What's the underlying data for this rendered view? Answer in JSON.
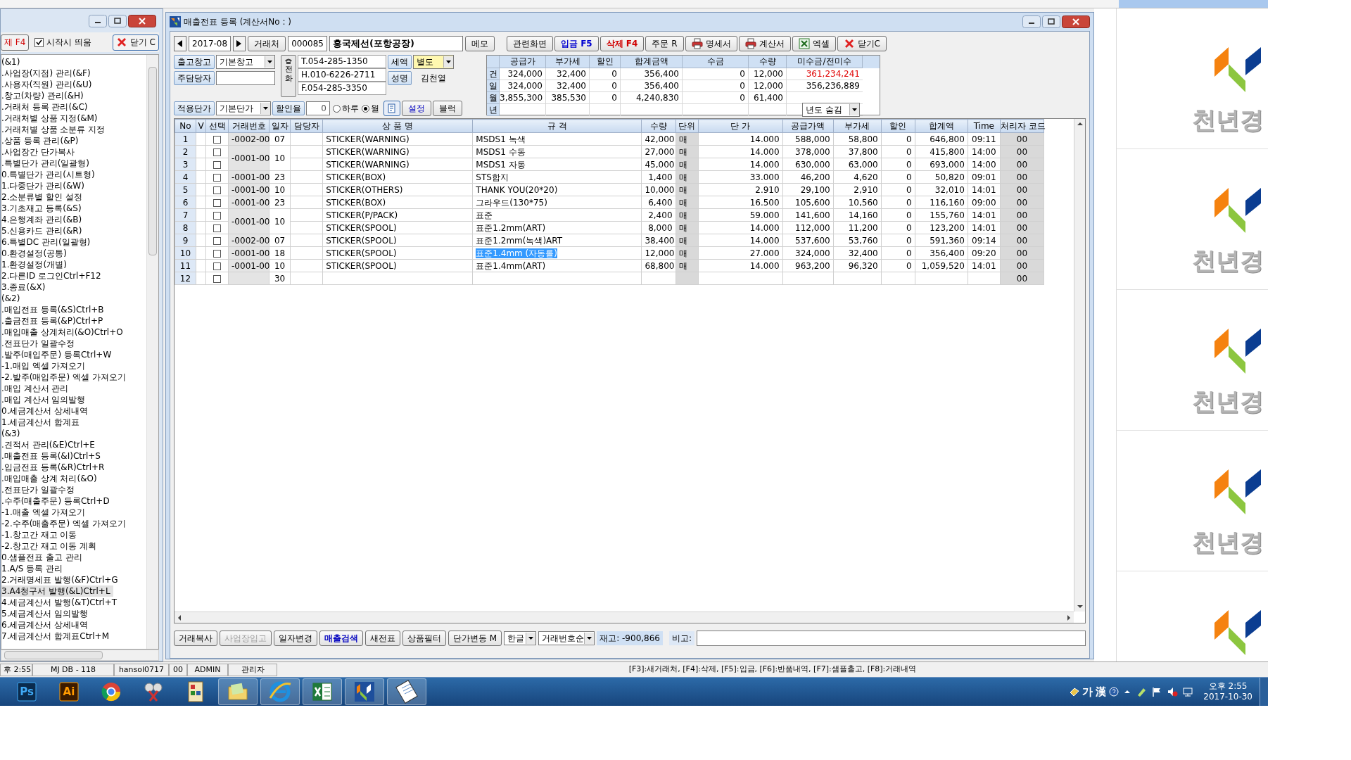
{
  "sidebar": {
    "delete_button": "제 F4",
    "startup_checkbox": {
      "label": "시작시 띄움",
      "checked": true
    },
    "close_button": "닫기 C",
    "items": [
      {
        "label": "(&1)",
        "selected": false
      },
      {
        "label": ".사업장(지점) 관리(&F)",
        "selected": false
      },
      {
        "label": ".사용자(직원) 관리(&U)",
        "selected": false
      },
      {
        "label": ".창고(차량) 관리(&H)",
        "selected": false
      },
      {
        "label": ".거래처 등록 관리(&C)",
        "selected": false
      },
      {
        "label": ".거래처별 상품 지정(&M)",
        "selected": false
      },
      {
        "label": ".거래처별 상품 소분류 지정",
        "selected": false
      },
      {
        "label": ".상품 등록 관리(&P)",
        "selected": false
      },
      {
        "label": ".사업장간 단가복사",
        "selected": false
      },
      {
        "label": ".특별단가 관리(일괄형)",
        "selected": false
      },
      {
        "label": "0.특별단가 관리(시트형)",
        "selected": false
      },
      {
        "label": "1.다중단가 관리(&W)",
        "selected": false
      },
      {
        "label": "2.소분류별 할인 설정",
        "selected": false
      },
      {
        "label": "3.기초재고 등록(&S)",
        "selected": false
      },
      {
        "label": "4.은행계좌 관리(&B)",
        "selected": false
      },
      {
        "label": "5.신용카드 관리(&R)",
        "selected": false
      },
      {
        "label": "6.특별DC 관리(일괄형)",
        "selected": false
      },
      {
        "label": "0.환경설정(공통)",
        "selected": false
      },
      {
        "label": "1.환경설정(개별)",
        "selected": false
      },
      {
        "label": "2.다른ID 로그인Ctrl+F12",
        "selected": false
      },
      {
        "label": "3.종료(&X)",
        "selected": false
      },
      {
        "label": "(&2)",
        "selected": false
      },
      {
        "label": ".매입전표 등록(&S)Ctrl+B",
        "selected": false
      },
      {
        "label": ".출금전표 등록(&P)Ctrl+P",
        "selected": false
      },
      {
        "label": ".매입매출 상계처리(&O)Ctrl+O",
        "selected": false
      },
      {
        "label": ".전표단가 일괄수정",
        "selected": false
      },
      {
        "label": ".발주(매입주문) 등록Ctrl+W",
        "selected": false
      },
      {
        "label": "-1.매입 엑셀 가져오기",
        "selected": false
      },
      {
        "label": "-2.발주(매입주문) 엑셀 가져오기",
        "selected": false
      },
      {
        "label": ".매입 계산서 관리",
        "selected": false
      },
      {
        "label": ".매입 계산서 임의발행",
        "selected": false
      },
      {
        "label": "0.세금계산서 상세내역",
        "selected": false
      },
      {
        "label": "1.세금계산서 합계표",
        "selected": false
      },
      {
        "label": "(&3)",
        "selected": false
      },
      {
        "label": ".견적서 관리(&E)Ctrl+E",
        "selected": false
      },
      {
        "label": ".매출전표 등록(&I)Ctrl+S",
        "selected": false
      },
      {
        "label": ".입금전표 등록(&R)Ctrl+R",
        "selected": false
      },
      {
        "label": ".매입매출 상계 처리(&O)",
        "selected": false
      },
      {
        "label": ".전표단가 일괄수정",
        "selected": false
      },
      {
        "label": ".수주(매출주문) 등록Ctrl+D",
        "selected": false
      },
      {
        "label": "-1.매출 엑셀 가져오기",
        "selected": false
      },
      {
        "label": "-2.수주(매출주문) 엑셀 가져오기",
        "selected": false
      },
      {
        "label": "-1.창고간 재고 이동",
        "selected": false
      },
      {
        "label": "-2.창고간 재고 이동 계획",
        "selected": false
      },
      {
        "label": "0.샘플전표 출고 관리",
        "selected": false
      },
      {
        "label": "1.A/S 등록 관리",
        "selected": false
      },
      {
        "label": "2.거래명세표 발행(&F)Ctrl+G",
        "selected": false
      },
      {
        "label": "3.A4청구서 발행(&L)Ctrl+L",
        "selected": true
      },
      {
        "label": "4.세금계산서 발행(&T)Ctrl+T",
        "selected": false
      },
      {
        "label": "5.세금계산서 임의발행",
        "selected": false
      },
      {
        "label": "6.세금계산서 상세내역",
        "selected": false
      },
      {
        "label": "7.세금계산서 합계표Ctrl+M",
        "selected": false
      }
    ]
  },
  "window": {
    "title": "매출전표 등록 (계산서No : )"
  },
  "header": {
    "month": "2017-08",
    "client_label": "거래처",
    "client_code": "000085",
    "client_name": "흥국제선(포항공장)",
    "memo_button": "메모"
  },
  "actions": [
    {
      "label": "관련화면",
      "kind": "plain"
    },
    {
      "label": "입금 F5",
      "kind": "blue"
    },
    {
      "label": "삭제 F4",
      "kind": "red"
    },
    {
      "label": "주문 R",
      "kind": "plain"
    },
    {
      "label": "명세서",
      "kind": "print"
    },
    {
      "label": "계산서",
      "kind": "print"
    },
    {
      "label": "엑셀",
      "kind": "excel"
    },
    {
      "label": "닫기C",
      "kind": "close"
    }
  ],
  "form": {
    "warehouse": {
      "label": "출고창고",
      "value": "기본창고"
    },
    "manager": {
      "label": "주담당자"
    },
    "phone": {
      "label": "전화",
      "lines": [
        "T.054-285-1350",
        "H.010-6226-2711",
        "F.054-285-3350"
      ]
    },
    "tax": {
      "label": "세액",
      "value": "별도"
    },
    "person": {
      "label": "성명",
      "value": "김천열"
    },
    "price": {
      "label": "적용단가",
      "value": "기본단가"
    },
    "discount": {
      "label": "할인율",
      "value": "0"
    },
    "period": [
      {
        "label": "하루",
        "selected": false
      },
      {
        "label": "월",
        "selected": true
      }
    ],
    "buttons": [
      "설정",
      "블럭"
    ]
  },
  "summary": {
    "columns": [
      "공급가",
      "부가세",
      "할인",
      "합계금액",
      "수금",
      "수량",
      "미수금/전미수"
    ],
    "rows": [
      {
        "label": "건",
        "values": [
          "324,000",
          "32,400",
          "0",
          "356,400",
          "0",
          "12,000"
        ],
        "balance": {
          "text": "361,234,241",
          "color": "#e00000"
        }
      },
      {
        "label": "일",
        "values": [
          "324,000",
          "32,400",
          "0",
          "356,400",
          "0",
          "12,000"
        ],
        "balance": {
          "text": "356,236,889",
          "color": "#000000"
        }
      },
      {
        "label": "월",
        "values": [
          "3,855,300",
          "385,530",
          "0",
          "4,240,830",
          "0",
          "61,400"
        ]
      },
      {
        "label": "년",
        "year_select": "년도 숨김"
      }
    ]
  },
  "table": {
    "columns": [
      "No",
      "V",
      "선택",
      "거래번호",
      "일자",
      "담당자",
      "상 품 명",
      "규 격",
      "수량",
      "단위",
      "단 가",
      "공급가액",
      "부가세",
      "할인",
      "합계액",
      "Time",
      "처리자 코드"
    ],
    "groups": [
      {
        "trade_no": "-0002-00",
        "date": "07",
        "rows": [
          {
            "no": "1",
            "checked": false,
            "product": "STICKER(WARNING)",
            "spec": "MSDS1 녹색",
            "selected": false,
            "qty": "42,000",
            "unit": "매",
            "price": "14.000",
            "supply": "588,000",
            "vat": "58,800",
            "discount": "0",
            "total": "646,800",
            "time": "09:11",
            "handler": "00"
          }
        ]
      },
      {
        "trade_no": "-0001-00",
        "date": "10",
        "rows": [
          {
            "no": "2",
            "checked": false,
            "product": "STICKER(WARNING)",
            "spec": "MSDS1 수동",
            "selected": false,
            "qty": "27,000",
            "unit": "매",
            "price": "14.000",
            "supply": "378,000",
            "vat": "37,800",
            "discount": "0",
            "total": "415,800",
            "time": "14:00",
            "handler": "00"
          },
          {
            "no": "3",
            "checked": false,
            "product": "STICKER(WARNING)",
            "spec": "MSDS1 자동",
            "selected": false,
            "qty": "45,000",
            "unit": "매",
            "price": "14.000",
            "supply": "630,000",
            "vat": "63,000",
            "discount": "0",
            "total": "693,000",
            "time": "14:00",
            "handler": "00"
          }
        ]
      },
      {
        "trade_no": "-0001-00",
        "date": "23",
        "rows": [
          {
            "no": "4",
            "checked": false,
            "product": "STICKER(BOX)",
            "spec": "STS합지",
            "selected": false,
            "qty": "1,400",
            "unit": "매",
            "price": "33.000",
            "supply": "46,200",
            "vat": "4,620",
            "discount": "0",
            "total": "50,820",
            "time": "09:01",
            "handler": "00"
          }
        ]
      },
      {
        "trade_no": "-0001-00",
        "date": "10",
        "rows": [
          {
            "no": "5",
            "checked": false,
            "product": "STICKER(OTHERS)",
            "spec": "THANK YOU(20*20)",
            "selected": false,
            "qty": "10,000",
            "unit": "매",
            "price": "2.910",
            "supply": "29,100",
            "vat": "2,910",
            "discount": "0",
            "total": "32,010",
            "time": "14:01",
            "handler": "00"
          }
        ]
      },
      {
        "trade_no": "-0001-00",
        "date": "23",
        "rows": [
          {
            "no": "6",
            "checked": false,
            "product": "STICKER(BOX)",
            "spec": "그라우드(130*75)",
            "selected": false,
            "qty": "6,400",
            "unit": "매",
            "price": "16.500",
            "supply": "105,600",
            "vat": "10,560",
            "discount": "0",
            "total": "116,160",
            "time": "09:00",
            "handler": "00"
          }
        ]
      },
      {
        "trade_no": "-0001-00",
        "date": "10",
        "rows": [
          {
            "no": "7",
            "checked": false,
            "product": "STICKER(P/PACK)",
            "spec": "표준",
            "selected": false,
            "qty": "2,400",
            "unit": "매",
            "price": "59.000",
            "supply": "141,600",
            "vat": "14,160",
            "discount": "0",
            "total": "155,760",
            "time": "14:01",
            "handler": "00"
          },
          {
            "no": "8",
            "checked": false,
            "product": "STICKER(SPOOL)",
            "spec": "표준1.2mm(ART)",
            "selected": false,
            "qty": "8,000",
            "unit": "매",
            "price": "14.000",
            "supply": "112,000",
            "vat": "11,200",
            "discount": "0",
            "total": "123,200",
            "time": "14:01",
            "handler": "00"
          }
        ]
      },
      {
        "trade_no": "-0002-00",
        "date": "07",
        "rows": [
          {
            "no": "9",
            "checked": false,
            "product": "STICKER(SPOOL)",
            "spec": "표준1.2mm(녹색)ART",
            "selected": false,
            "qty": "38,400",
            "unit": "매",
            "price": "14.000",
            "supply": "537,600",
            "vat": "53,760",
            "discount": "0",
            "total": "591,360",
            "time": "09:14",
            "handler": "00"
          }
        ]
      },
      {
        "trade_no": "-0001-00",
        "date": "18",
        "rows": [
          {
            "no": "10",
            "checked": false,
            "product": "STICKER(SPOOL)",
            "spec": "표준1.4mm (자동롤)",
            "selected": true,
            "qty": "12,000",
            "unit": "매",
            "price": "27.000",
            "supply": "324,000",
            "vat": "32,400",
            "discount": "0",
            "total": "356,400",
            "time": "09:20",
            "handler": "00"
          }
        ]
      },
      {
        "trade_no": "-0001-00",
        "date": "10",
        "rows": [
          {
            "no": "11",
            "checked": false,
            "product": "STICKER(SPOOL)",
            "spec": "표준1.4mm(ART)",
            "selected": false,
            "qty": "68,800",
            "unit": "매",
            "price": "14.000",
            "supply": "963,200",
            "vat": "96,320",
            "discount": "0",
            "total": "1,059,520",
            "time": "14:01",
            "handler": "00"
          }
        ]
      },
      {
        "date": "30",
        "rows": [
          {
            "no": "12",
            "checked": false,
            "selected": false,
            "handler": "00"
          }
        ]
      }
    ]
  },
  "bottom_bar": {
    "buttons": [
      {
        "label": "거래복사",
        "kind": "plain"
      },
      {
        "label": "사업장입고",
        "kind": "disabled"
      },
      {
        "label": "일자변경",
        "kind": "plain"
      },
      {
        "label": "매출검색",
        "kind": "bold"
      },
      {
        "label": "새전표",
        "kind": "plain"
      },
      {
        "label": "상품필터",
        "kind": "plain"
      },
      {
        "label": "단가변동 M",
        "kind": "plain"
      }
    ],
    "selects": [
      "한글",
      "거래번호순"
    ],
    "stock": "재고: -900,866",
    "note_label": "비고:"
  },
  "status_bar": {
    "cells": [
      "후 2:55",
      "MJ DB - 118",
      "hansol0717",
      "00",
      "ADMIN",
      "관리자"
    ],
    "hint": "[F3]:새거래처, [F4]:삭제, [F5]:입금, [F6]:반품내역, [F7]:샘플출고, [F8]:거래내역"
  },
  "taskbar": {
    "apps": [
      {
        "kind": "ps",
        "label": "Ps",
        "open": false
      },
      {
        "kind": "ai",
        "label": "Ai",
        "open": false
      },
      {
        "kind": "chrome",
        "open": false
      },
      {
        "kind": "tool",
        "open": false
      },
      {
        "kind": "mfc",
        "open": false
      },
      {
        "kind": "folder",
        "open": true
      },
      {
        "kind": "ie",
        "open": true
      },
      {
        "kind": "excel",
        "open": true
      },
      {
        "kind": "logo",
        "open": true
      },
      {
        "kind": "notepad",
        "open": true
      }
    ],
    "ime": [
      "가",
      "漢"
    ],
    "time": "오후 2:55",
    "date": "2017-10-30"
  },
  "tiles": [
    {
      "kind": "captioned",
      "caption": "천년경"
    },
    {
      "kind": "captioned",
      "caption": "천년경"
    },
    {
      "kind": "captioned",
      "caption": "천년경"
    },
    {
      "kind": "captioned",
      "caption": "천년경"
    },
    {
      "kind": "logo"
    }
  ]
}
